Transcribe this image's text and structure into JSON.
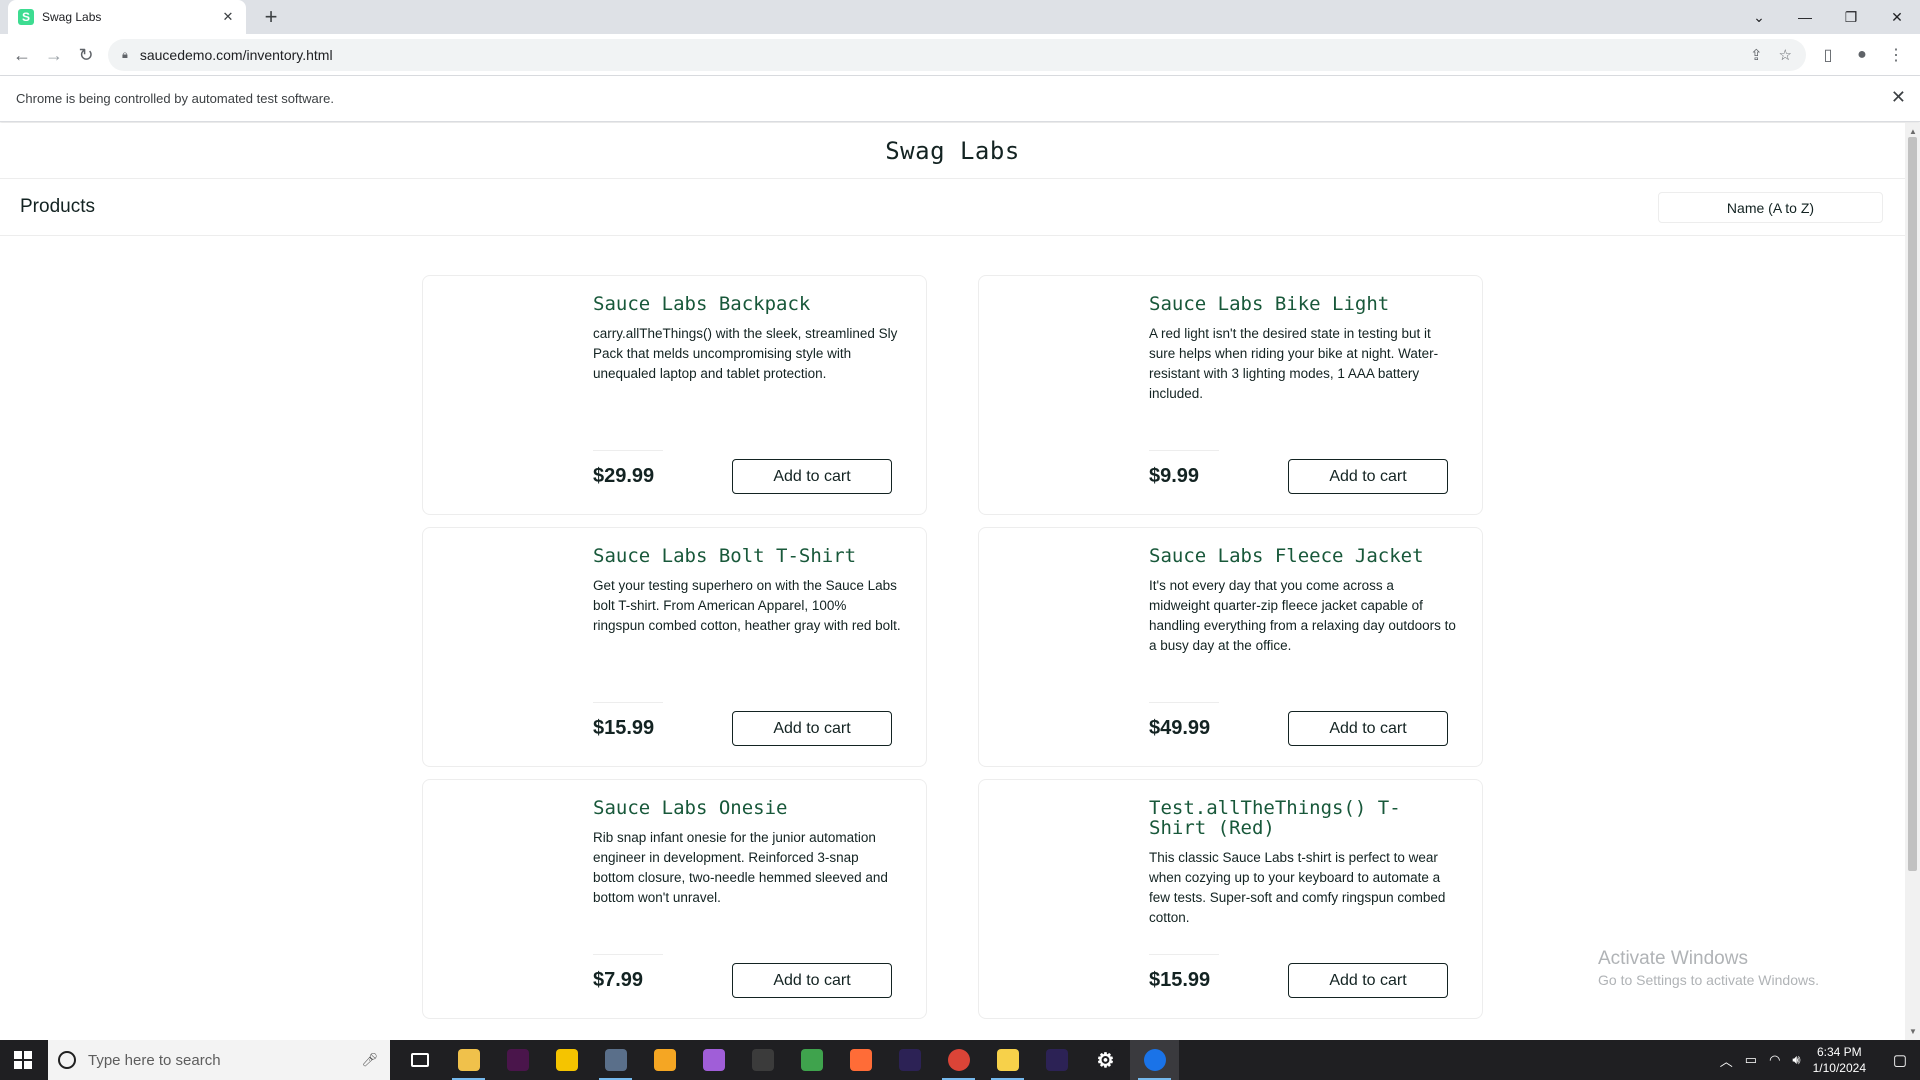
{
  "browser": {
    "tab_title": "Swag Labs",
    "tab_favicon": "saucelabs-icon",
    "new_tab": "+",
    "url": "saucedemo.com/inventory.html",
    "infobar_text": "Chrome is being controlled by automated test software."
  },
  "app": {
    "logo": "Swag Labs",
    "page_title": "Products",
    "sort_value": "Name (A to Z)"
  },
  "products": [
    {
      "name": "Sauce Labs Backpack",
      "description": "carry.allTheThings() with the sleek, streamlined Sly Pack that melds uncompromising style with unequaled laptop and tablet protection.",
      "price": "$29.99",
      "button": "Add to cart"
    },
    {
      "name": "Sauce Labs Bike Light",
      "description": "A red light isn't the desired state in testing but it sure helps when riding your bike at night. Water-resistant with 3 lighting modes, 1 AAA battery included.",
      "price": "$9.99",
      "button": "Add to cart"
    },
    {
      "name": "Sauce Labs Bolt T-Shirt",
      "description": "Get your testing superhero on with the Sauce Labs bolt T-shirt. From American Apparel, 100% ringspun combed cotton, heather gray with red bolt.",
      "price": "$15.99",
      "button": "Add to cart"
    },
    {
      "name": "Sauce Labs Fleece Jacket",
      "description": "It's not every day that you come across a midweight quarter-zip fleece jacket capable of handling everything from a relaxing day outdoors to a busy day at the office.",
      "price": "$49.99",
      "button": "Add to cart"
    },
    {
      "name": "Sauce Labs Onesie",
      "description": "Rib snap infant onesie for the junior automation engineer in development. Reinforced 3-snap bottom closure, two-needle hemmed sleeved and bottom won't unravel.",
      "price": "$7.99",
      "button": "Add to cart"
    },
    {
      "name": "Test.allTheThings() T-Shirt (Red)",
      "description": "This classic Sauce Labs t-shirt is perfect to wear when cozying up to your keyboard to automate a few tests. Super-soft and comfy ringspun combed cotton.",
      "price": "$15.99",
      "button": "Add to cart"
    }
  ],
  "watermark": {
    "title": "Activate Windows",
    "subtitle": "Go to Settings to activate Windows."
  },
  "taskbar": {
    "search_placeholder": "Type here to search",
    "time": "6:34 PM",
    "date": "1/10/2024",
    "apps": [
      {
        "name": "task-view-icon",
        "color": "#1f1f22"
      },
      {
        "name": "file-explorer-icon",
        "color": "#f0c14b"
      },
      {
        "name": "slack-icon",
        "color": "#4a154b"
      },
      {
        "name": "norton-icon",
        "color": "#f5c400"
      },
      {
        "name": "snipping-tool-icon",
        "color": "#5a6f8a"
      },
      {
        "name": "github-icon",
        "color": "#f5a623"
      },
      {
        "name": "onenote-icon",
        "color": "#a05ed8"
      },
      {
        "name": "calculator-icon",
        "color": "#3b3b3b"
      },
      {
        "name": "notepad-icon",
        "color": "#3fa34d"
      },
      {
        "name": "postman-icon",
        "color": "#ff6c37"
      },
      {
        "name": "eclipse-icon",
        "color": "#2c2255"
      },
      {
        "name": "chrome-alt-icon",
        "color": "#db4437"
      },
      {
        "name": "sticky-notes-icon",
        "color": "#f7d14a"
      },
      {
        "name": "eclipse-2-icon",
        "color": "#2c2255"
      },
      {
        "name": "settings-icon",
        "color": "#1f1f22"
      },
      {
        "name": "chrome-icon",
        "color": "#1a73e8"
      }
    ]
  },
  "colors": {
    "product_name": "#18583a",
    "text": "#132322",
    "border": "#ededed"
  }
}
